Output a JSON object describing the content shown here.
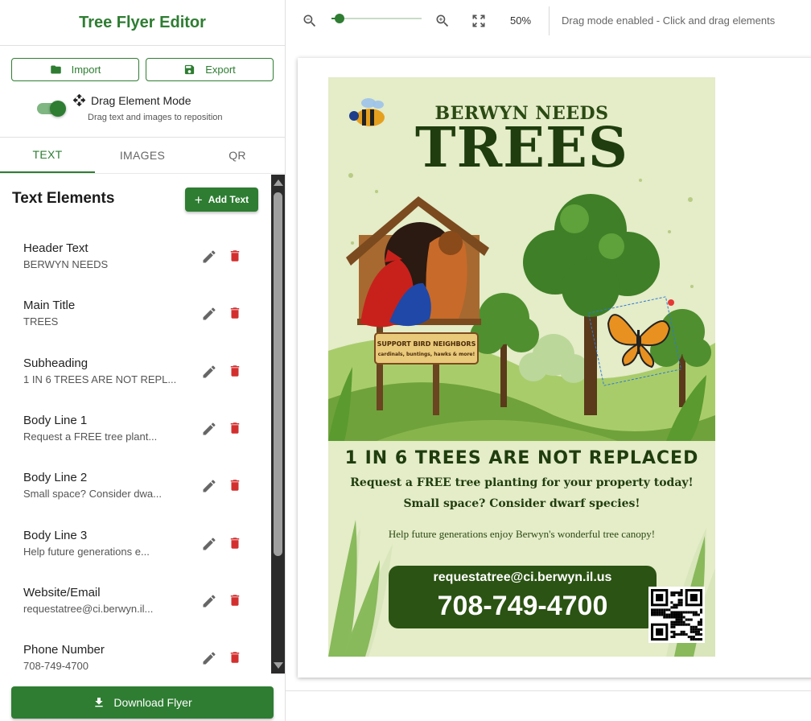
{
  "app": {
    "title": "Tree Flyer Editor"
  },
  "io": {
    "import_label": "Import",
    "export_label": "Export"
  },
  "drag_mode": {
    "label": "Drag Element Mode",
    "hint": "Drag text and images to reposition",
    "enabled": true
  },
  "tabs": [
    {
      "label": "TEXT",
      "active": true
    },
    {
      "label": "IMAGES",
      "active": false
    },
    {
      "label": "QR",
      "active": false
    }
  ],
  "text_panel": {
    "heading": "Text Elements",
    "add_label": "Add Text",
    "items": [
      {
        "title": "Header Text",
        "value": "BERWYN NEEDS"
      },
      {
        "title": "Main Title",
        "value": "TREES"
      },
      {
        "title": "Subheading",
        "value": "1 IN 6 TREES ARE NOT REPL..."
      },
      {
        "title": "Body Line 1",
        "value": "Request a FREE tree plant..."
      },
      {
        "title": "Body Line 2",
        "value": "Small space? Consider dwa..."
      },
      {
        "title": "Body Line 3",
        "value": "Help future generations e..."
      },
      {
        "title": "Website/Email",
        "value": "requestatree@ci.berwyn.il..."
      },
      {
        "title": "Phone Number",
        "value": "708-749-4700"
      }
    ]
  },
  "download_label": "Download Flyer",
  "toolbar": {
    "zoom_label": "50%",
    "zoom_value": 0.5,
    "status": "Drag mode enabled - Click and drag elements"
  },
  "flyer": {
    "header": "BERWYN NEEDS",
    "title": "TREES",
    "subheading": "1 IN 6 TREES ARE NOT REPLACED",
    "body1": "Request a FREE tree planting for your property today!",
    "body2": "Small space? Consider dwarf species!",
    "body3": "Help future generations enjoy Berwyn's wonderful tree canopy!",
    "email": "requestatree@ci.berwyn.il.us",
    "phone": "708-749-4700",
    "sign_line1": "SUPPORT BIRD NEIGHBORS",
    "sign_line2": "cardinals, buntings, hawks & more!"
  },
  "colors": {
    "primary": "#2e7d32",
    "delete": "#d32f2f",
    "flyer_bg": "#e4ecc8",
    "flyer_text": "#1f3d0e"
  }
}
